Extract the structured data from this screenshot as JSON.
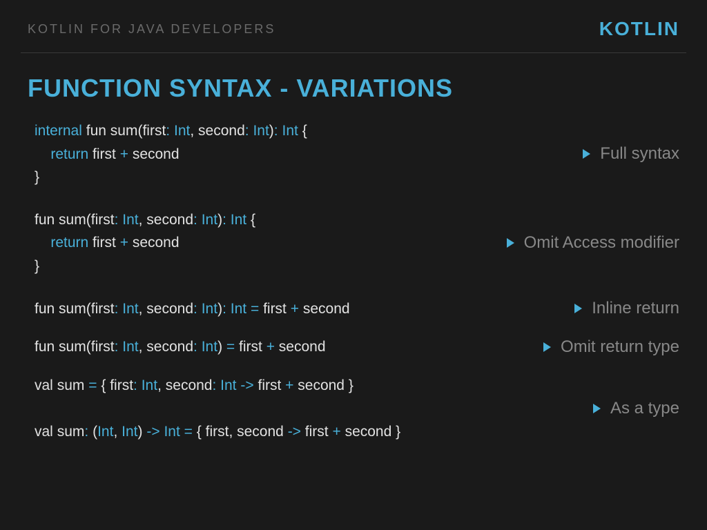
{
  "header": {
    "breadcrumb": "KOTLIN FOR JAVA DEVELOPERS",
    "brand": "KOTLIN"
  },
  "title": "FUNCTION SYNTAX - VARIATIONS",
  "bullets": {
    "full": "Full syntax",
    "omitAccess": "Omit Access modifier",
    "inline": "Inline return",
    "omitType": "Omit return type",
    "asType": "As a type"
  },
  "code": {
    "kw_internal": "internal",
    "kw_fun": "fun",
    "kw_return": "return",
    "kw_val": "val",
    "name_sum": "sum",
    "p_first": "first",
    "p_second": "second",
    "t_int": "Int",
    "sym_colon": ":",
    "sym_comma": ",",
    "sym_lparen": "(",
    "sym_rparen": ")",
    "sym_lbrace": "{",
    "sym_rbrace": "}",
    "sym_plus": "+",
    "sym_eq": "=",
    "sym_arrow": "->",
    "sp": " ",
    "indent": "    "
  }
}
